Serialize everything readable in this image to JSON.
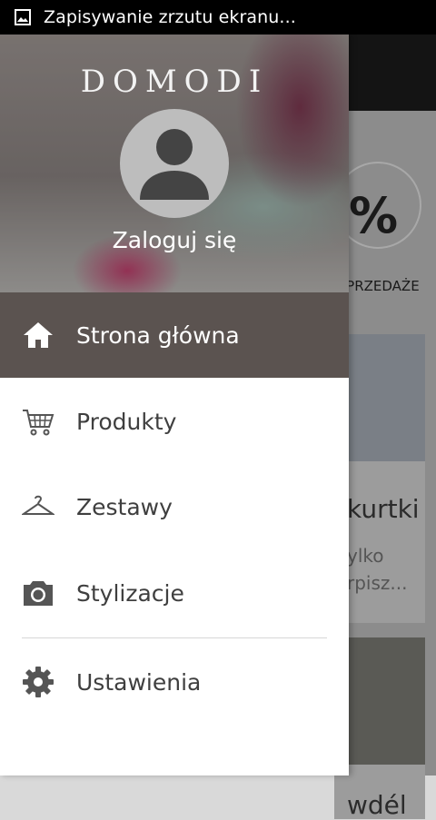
{
  "status_bar": {
    "notification": "Zapisywanie zrzutu ekranu..."
  },
  "drawer": {
    "brand": "DOMODI",
    "login_label": "Zaloguj się",
    "items": [
      {
        "label": "Strona główna",
        "icon": "home-icon",
        "active": true
      },
      {
        "label": "Produkty",
        "icon": "cart-icon"
      },
      {
        "label": "Zestawy",
        "icon": "hanger-icon"
      },
      {
        "label": "Stylizacje",
        "icon": "camera-icon"
      },
      {
        "label": "Ustawienia",
        "icon": "gear-icon"
      }
    ]
  },
  "background": {
    "category_label": "YPRZEDAŻE",
    "category_symbol": "%",
    "card1_title": "kurtki",
    "card1_sub1": "ylko",
    "card1_sub2": "rpisz...",
    "card2_title": "wdél"
  },
  "colors": {
    "active_bg": "#5b5350",
    "header_text": "#ffffff",
    "menu_text": "#3f3f3f"
  }
}
